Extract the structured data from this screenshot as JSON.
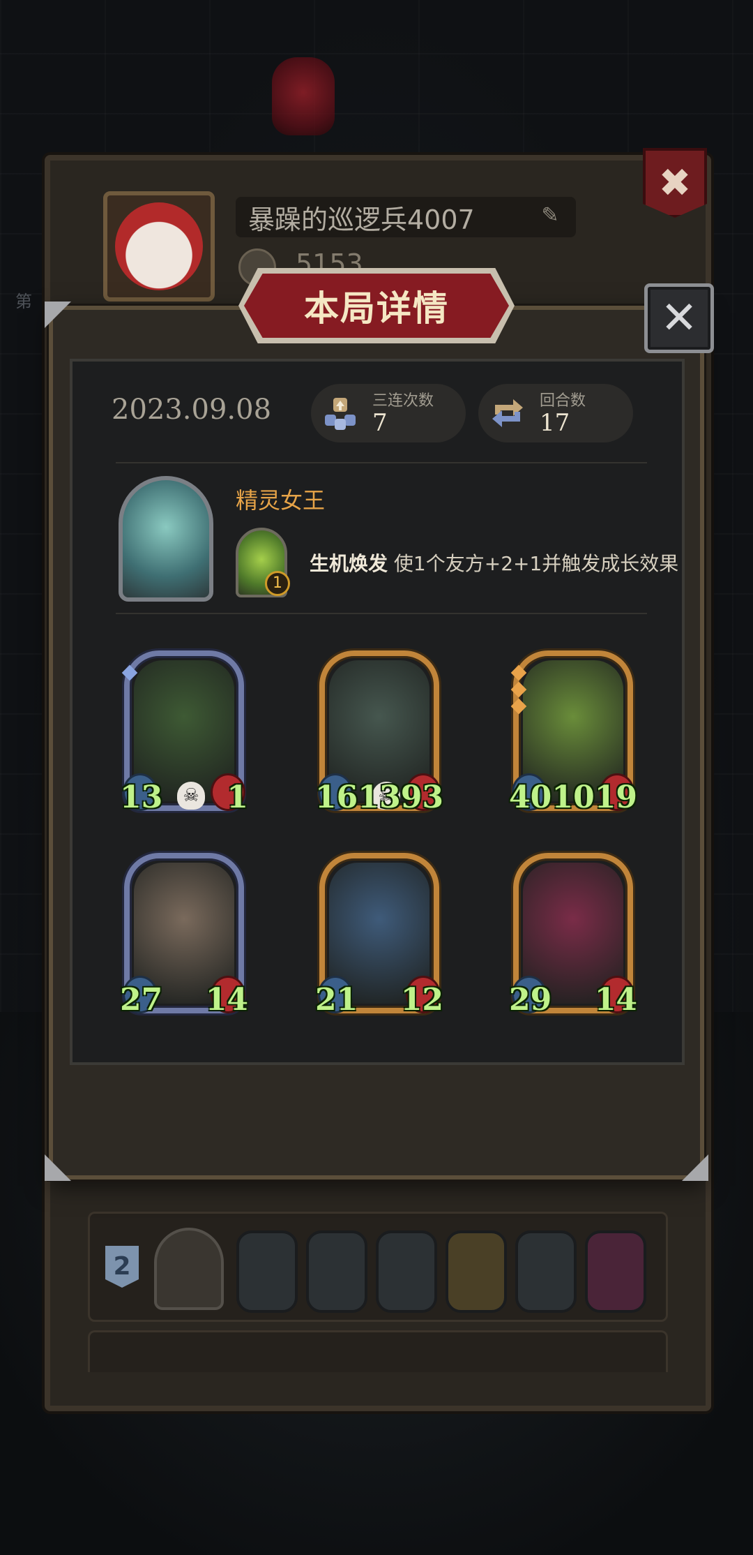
{
  "colors": {
    "banner_red": "#861b22",
    "hero_name": "#e7a448",
    "stat_green": "#bff28a",
    "attack_blue": "#3b5f8a",
    "health_red": "#b22b2e",
    "gold_frame": "#c1853a",
    "silver_frame": "#6f7aa6"
  },
  "background_profile": {
    "player_name": "暴躁的巡逻兵4007",
    "coins": "5153",
    "edit_icon": "pencil-icon",
    "close_icon": "close-icon",
    "side_label_left": "第"
  },
  "dialog": {
    "title": "本局详情",
    "close_icon": "close-icon"
  },
  "summary": {
    "date": "2023.09.08",
    "triples": {
      "label": "三连次数",
      "value": "7",
      "icon": "triple-merge-icon"
    },
    "rounds": {
      "label": "回合数",
      "value": "17",
      "icon": "round-cycle-icon"
    }
  },
  "hero": {
    "name": "精灵女王",
    "skill": {
      "name": "生机焕发",
      "description": "使1个友方+2+1并触发成长效果",
      "level": "1",
      "icon": "sprout-skill-icon"
    }
  },
  "units": [
    {
      "name": "vine-heart-unit",
      "attack": "13",
      "health": "1",
      "frame": "silver",
      "skull": true,
      "pips": 1,
      "art": "#3e5a34"
    },
    {
      "name": "armored-knight-unit",
      "attack": "161",
      "health": "393",
      "frame": "gold",
      "skull": true,
      "pips": 0,
      "art": "#46574f"
    },
    {
      "name": "leaf-sprite-unit",
      "attack": "401",
      "health": "1019",
      "frame": "gold",
      "skull": false,
      "pips": 3,
      "art": "#6a8d3a"
    },
    {
      "name": "cyborg-scientist-unit",
      "attack": "27",
      "health": "14",
      "frame": "silver",
      "skull": false,
      "pips": 0,
      "art": "#7a6a5c"
    },
    {
      "name": "blue-elf-witch-unit",
      "attack": "21",
      "health": "12",
      "frame": "gold",
      "skull": false,
      "pips": 0,
      "art": "#3f5b7a"
    },
    {
      "name": "jester-clown-unit",
      "attack": "29",
      "health": "14",
      "frame": "gold",
      "skull": false,
      "pips": 0,
      "art": "#7a2c48"
    }
  ],
  "history": {
    "row_rank": "2"
  }
}
